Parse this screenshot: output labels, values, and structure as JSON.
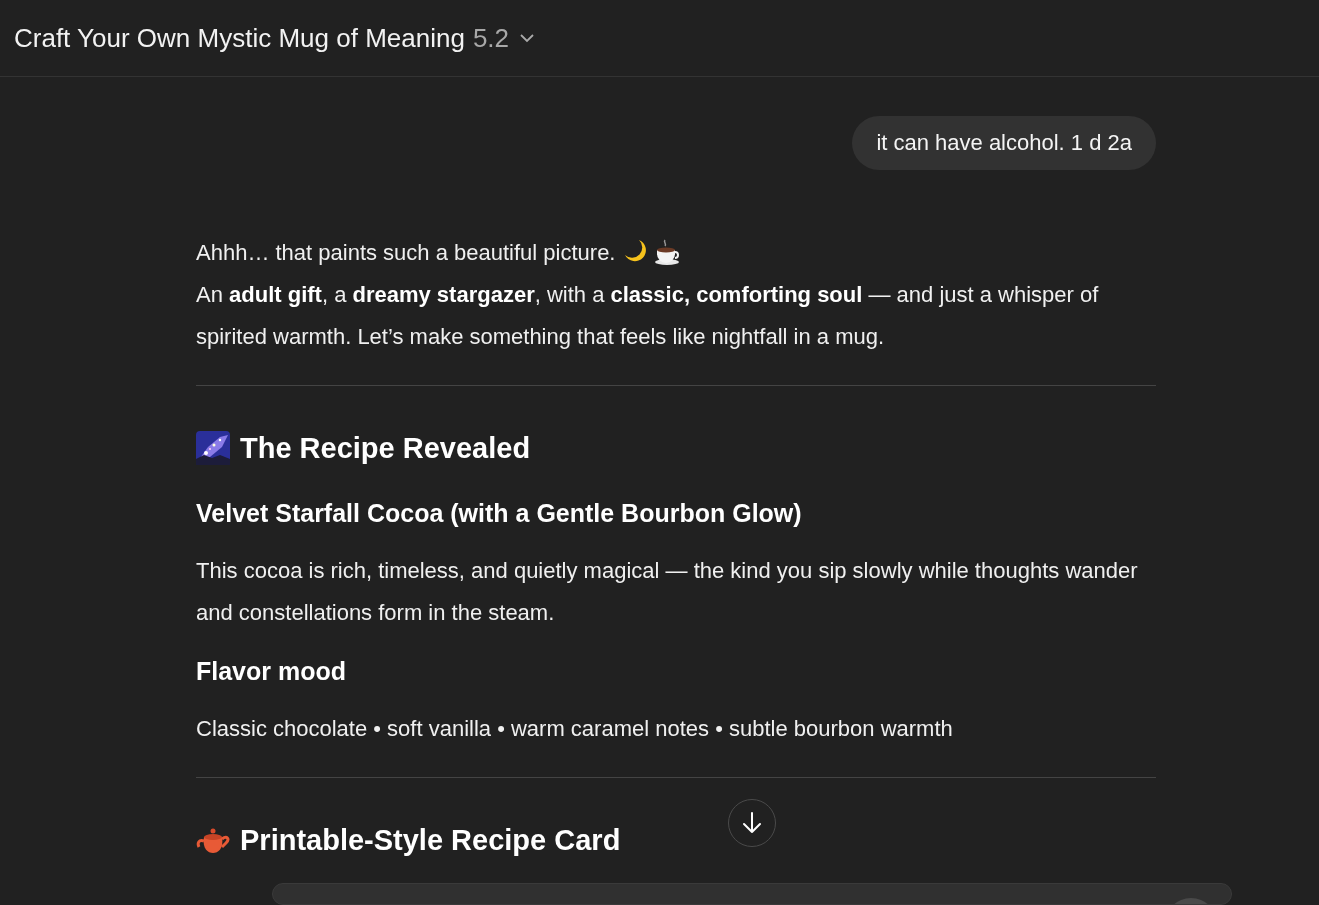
{
  "header": {
    "title": "Craft Your Own Mystic Mug of Meaning",
    "model": "5.2"
  },
  "user_message": {
    "text": "it can have alcohol. 1 d 2a"
  },
  "reply": {
    "blocks": [
      {
        "kind": "paragraph",
        "lines": [
          "Ahhh… that paints such a beautiful picture.",
          "An **adult gift**, a **dreamy stargazer**, with a **classic, comforting soul** — and just a whisper of spirited warmth. Let’s make something that feels like nightfall in a mug."
        ]
      },
      {
        "kind": "rule"
      },
      {
        "kind": "heading",
        "text": "The Recipe Revealed"
      },
      {
        "kind": "subheading",
        "text": "Velvet Starfall Cocoa (with a Gentle Bourbon Glow)"
      },
      {
        "kind": "paragraph",
        "lines": [
          "This cocoa is rich, timeless, and quietly magical — the kind you sip slowly while thoughts wander and constellations form in the steam."
        ]
      },
      {
        "kind": "subheading",
        "text": "Flavor mood"
      },
      {
        "kind": "paragraph",
        "lines": [
          "Classic chocolate • soft vanilla • warm caramel notes • subtle bourbon warmth"
        ]
      },
      {
        "kind": "rule"
      },
      {
        "kind": "heading",
        "text": "Printable-Style Recipe Card"
      }
    ]
  }
}
